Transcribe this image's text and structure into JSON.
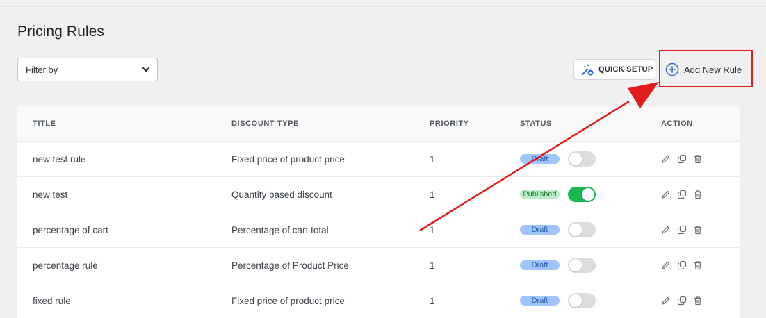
{
  "page": {
    "title": "Pricing Rules"
  },
  "filter": {
    "selected": "Filter by"
  },
  "toolbar": {
    "quick_setup_label": "QUICK SETUP",
    "add_rule_label": "Add New Rule"
  },
  "table": {
    "headers": {
      "title": "TITLE",
      "discount_type": "DISCOUNT TYPE",
      "priority": "PRIORITY",
      "status": "STATUS",
      "action": "ACTION"
    },
    "rows": [
      {
        "title": "new test rule",
        "discount_type": "Fixed price of product price",
        "priority": "1",
        "status": "Draft",
        "enabled": false
      },
      {
        "title": "new test",
        "discount_type": "Quantity based discount",
        "priority": "1",
        "status": "Published",
        "enabled": true
      },
      {
        "title": "percentage of cart",
        "discount_type": "Percentage of cart total",
        "priority": "1",
        "status": "Draft",
        "enabled": false
      },
      {
        "title": "percentage rule",
        "discount_type": "Percentage of Product Price",
        "priority": "1",
        "status": "Draft",
        "enabled": false
      },
      {
        "title": "fixed rule",
        "discount_type": "Fixed price of product price",
        "priority": "1",
        "status": "Draft",
        "enabled": false
      }
    ]
  },
  "colors": {
    "annotation": "#e21b1b",
    "toggle_on": "#18b74f",
    "draft_badge": "#9ec5ff",
    "published_badge": "#b9efc6"
  },
  "icons": {
    "filter": "chevron-down-icon",
    "quick_setup": "wizard-gear-icon",
    "add": "plus-circle-icon",
    "edit": "pencil-icon",
    "copy": "copy-icon",
    "delete": "trash-icon"
  }
}
